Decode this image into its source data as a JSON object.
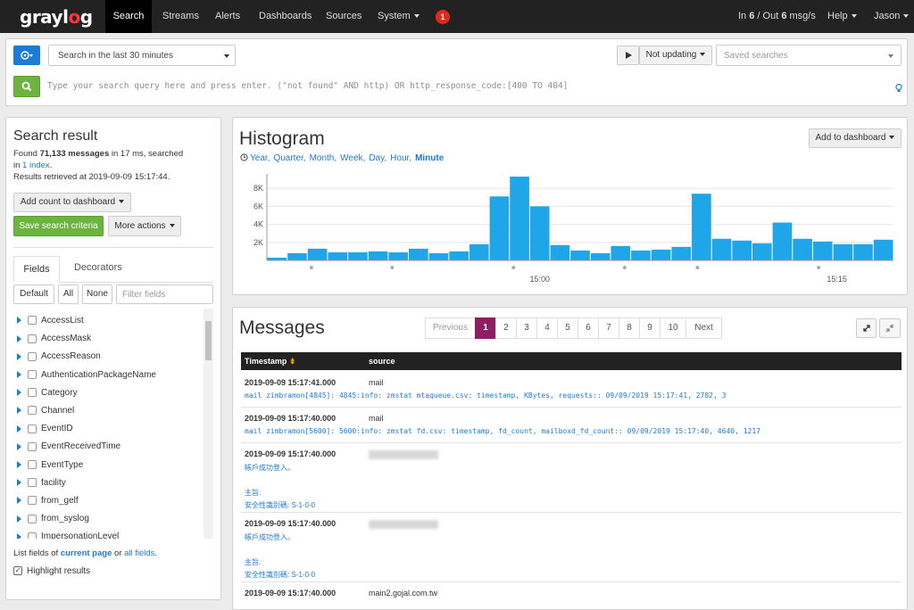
{
  "nav": {
    "logo": [
      "gray",
      "l",
      "o",
      "g"
    ],
    "items": [
      "Search",
      "Streams",
      "Alerts",
      "Dashboards",
      "Sources",
      "System"
    ],
    "notification_count": "1",
    "throughput_prefix": "In ",
    "throughput_in": "6",
    "throughput_mid": " / Out ",
    "throughput_out": "6",
    "throughput_suffix": " msg/s",
    "help": "Help",
    "user": "Jason"
  },
  "search": {
    "range": "Search in the last 30 minutes",
    "refresh": "Not updating",
    "saved_placeholder": "Saved searches",
    "query_placeholder": "Type your search query here and press enter. (\"not found\" AND http) OR http_response_code:[400 TO 404]"
  },
  "result": {
    "title": "Search result",
    "found_prefix": "Found ",
    "count": "71,133 messages",
    "found_mid": " in 17 ms, searched",
    "in_prefix": "in ",
    "index_link": "1 index",
    "in_suffix": ".",
    "retrieved": "Results retrieved at 2019-09-09 15:17:44.",
    "add_count": "Add count to dashboard",
    "save": "Save search criteria",
    "more": "More actions"
  },
  "sidebar": {
    "tabs": [
      "Fields",
      "Decorators"
    ],
    "filters": [
      "Default",
      "All",
      "None"
    ],
    "filter_placeholder": "Filter fields",
    "fields": [
      "AccessList",
      "AccessMask",
      "AccessReason",
      "AuthenticationPackageName",
      "Category",
      "Channel",
      "EventID",
      "EventReceivedTime",
      "EventType",
      "facility",
      "from_gelf",
      "from_syslog",
      "ImpersonationLevel"
    ],
    "list_prefix": "List fields of ",
    "current_page": "current page",
    "list_or": " or ",
    "all_fields": "all fields",
    "list_end": ".",
    "highlight": "Highlight results"
  },
  "histogram": {
    "title": "Histogram",
    "add": "Add to dashboard",
    "resolutions": [
      "Year",
      "Quarter",
      "Month",
      "Week",
      "Day",
      "Hour",
      "Minute"
    ],
    "active_resolution": "Minute"
  },
  "chart_data": {
    "type": "bar",
    "series": [
      {
        "values": [
          300,
          800,
          1300,
          900,
          900,
          1000,
          900,
          1300,
          800,
          1000,
          1800,
          7100,
          9300,
          6000,
          1700,
          1100,
          800,
          1600,
          1100,
          1200,
          1500,
          7400,
          2400,
          2200,
          1900,
          4200,
          2400,
          2100,
          1800,
          1800,
          2300
        ]
      }
    ],
    "ylabels": [
      "2K",
      "4K",
      "6K",
      "8K"
    ],
    "ylim": [
      0,
      9600
    ],
    "xlabels": [
      "15:00",
      "15:15"
    ],
    "grid": true
  },
  "messages": {
    "title": "Messages",
    "pages": [
      "Previous",
      "1",
      "2",
      "3",
      "4",
      "5",
      "6",
      "7",
      "8",
      "9",
      "10",
      "Next"
    ],
    "col_ts": "Timestamp",
    "col_src": "source",
    "rows": [
      {
        "ts": "2019-09-09 15:17:41.000",
        "src": "mail",
        "lines": [
          "mail zimbramon[4845]: 4845:info: zmstat mtaqueue.csv: timestamp, KBytes, requests:: 09/09/2019 15:17:41, 2782, 3"
        ]
      },
      {
        "ts": "2019-09-09 15:17:40.000",
        "src": "mail",
        "lines": [
          "mail zimbramon[5600]: 5600:info: zmstat fd.csv: timestamp, fd_count, mailboxd_fd_count:: 09/09/2019 15:17:40, 4640, 1217"
        ]
      },
      {
        "ts": "2019-09-09 15:17:40.000",
        "src": "",
        "lines": [
          "帳戶成功登入。",
          "",
          "主旨:",
          "安全性識別碼: S-1-0-0"
        ]
      },
      {
        "ts": "2019-09-09 15:17:40.000",
        "src": "",
        "lines": [
          "帳戶成功登入。",
          "",
          "主旨:",
          "安全性識別碼: S-1-0-0"
        ]
      },
      {
        "ts": "2019-09-09 15:17:40.000",
        "src": "main2.gojal.com.tw",
        "lines": []
      }
    ]
  }
}
